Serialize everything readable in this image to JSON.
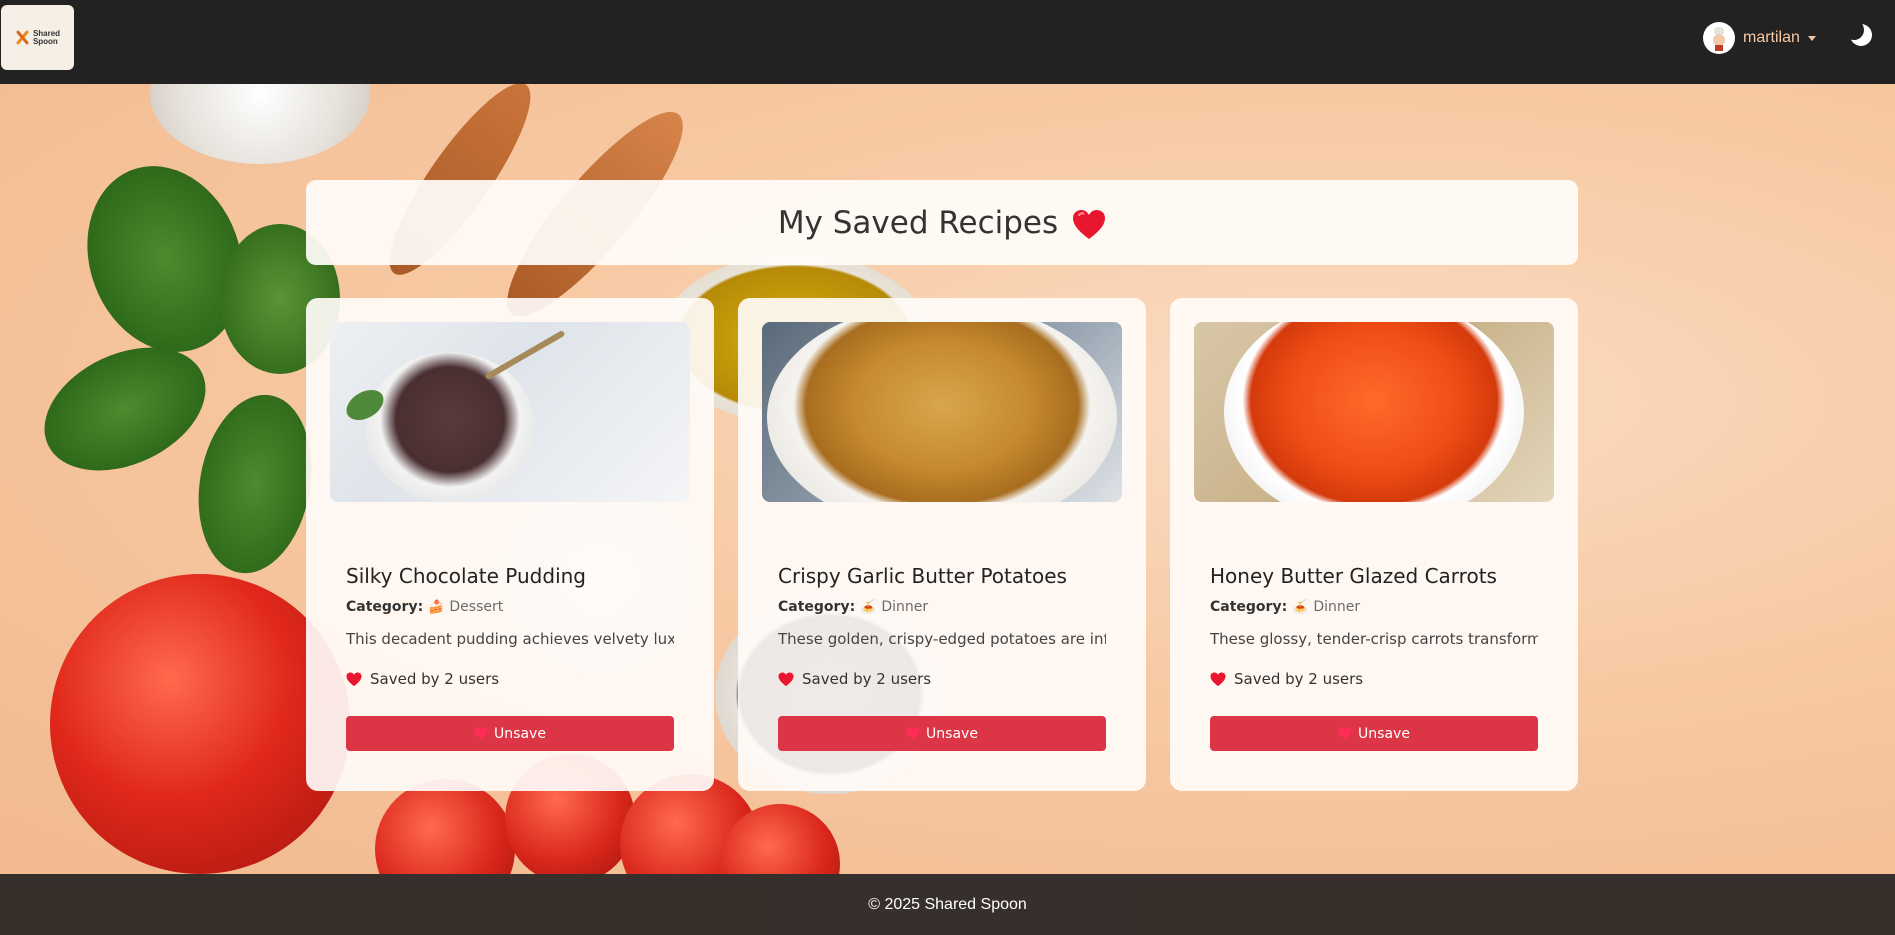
{
  "navbar": {
    "logo_text_line1": "Shared",
    "logo_text_line2": "Spoon",
    "username": "martilan",
    "theme_icon": "moon-icon"
  },
  "page": {
    "title": "My Saved Recipes"
  },
  "cards": [
    {
      "title": "Silky Chocolate Pudding",
      "category_label": "Category:",
      "category_emoji": "🍰",
      "category": "Dessert",
      "description": "This decadent pudding achieves velvety luxu",
      "saved_text": "Saved by 2 users",
      "button_label": "Unsave"
    },
    {
      "title": "Crispy Garlic Butter Potatoes",
      "category_label": "Category:",
      "category_emoji": "🍝",
      "category": "Dinner",
      "description": "These golden, crispy-edged potatoes are infu",
      "saved_text": "Saved by 2 users",
      "button_label": "Unsave"
    },
    {
      "title": "Honey Butter Glazed Carrots",
      "category_label": "Category:",
      "category_emoji": "🍝",
      "category": "Dinner",
      "description": "These glossy, tender-crisp carrots transform",
      "saved_text": "Saved by 2 users",
      "button_label": "Unsave"
    }
  ],
  "footer": {
    "text": "© 2025 Shared Spoon"
  },
  "colors": {
    "navbar_bg": "#222222",
    "accent": "#dc3545",
    "username": "#f6c9a4",
    "footer_bg": "#282421"
  }
}
